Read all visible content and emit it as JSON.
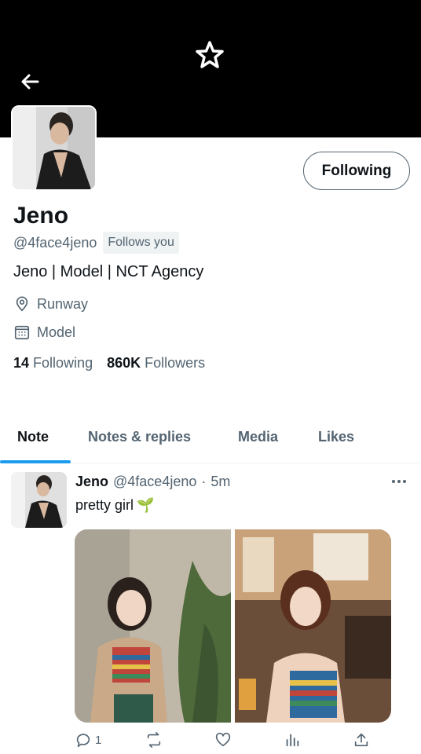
{
  "profile": {
    "name": "Jeno",
    "handle": "@4face4jeno",
    "follows_you": "Follows you",
    "bio": "Jeno | Model | NCT Agency",
    "location": "Runway",
    "category": "Model",
    "following_count": "14",
    "following_label": "Following",
    "followers_count": "860K",
    "followers_label": "Followers",
    "follow_button": "Following"
  },
  "tabs": [
    {
      "label": "Note",
      "active": true
    },
    {
      "label": "Notes & replies",
      "active": false
    },
    {
      "label": "Media",
      "active": false
    },
    {
      "label": "Likes",
      "active": false
    }
  ],
  "post": {
    "author": "Jeno",
    "handle": "@4face4jeno",
    "dot": "·",
    "time": "5m",
    "text": "pretty girl",
    "emoji": "🌱",
    "reply_count": "1"
  },
  "colors": {
    "accent": "#1d9bf0",
    "banner": "#000000",
    "text_primary": "#0f1419",
    "text_secondary": "#536471"
  },
  "icons": [
    "back-arrow-icon",
    "star-logo-icon",
    "location-pin-icon",
    "calendar-grid-icon",
    "more-icon",
    "reply-icon",
    "repost-icon",
    "like-icon",
    "views-icon",
    "share-icon"
  ]
}
